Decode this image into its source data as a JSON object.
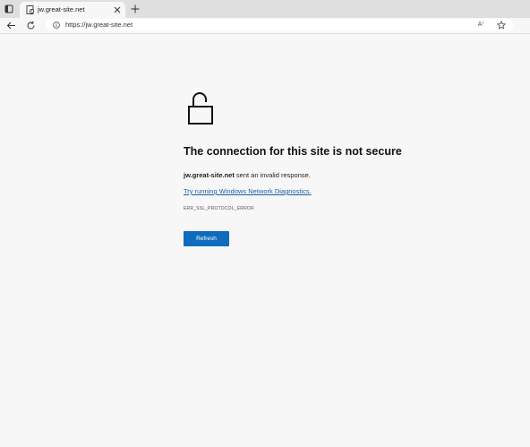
{
  "browser": {
    "tab": {
      "title": "jw.great-site.net"
    },
    "address_bar": {
      "url": "https://jw.great-site.net"
    },
    "toolbar_icons": [
      "back-arrow-icon",
      "reload-icon",
      "info-icon",
      "read-aloud-icon",
      "star-icon"
    ],
    "read_aloud_label": "A⁾"
  },
  "page": {
    "icon": "unlocked-padlock-icon",
    "title": "The connection for this site is not secure",
    "description_host": "jw.great-site.net",
    "description_rest": " sent an invalid response.",
    "diagnostics_link": "Try running Windows Network Diagnostics",
    "diagnostics_suffix": ".",
    "error_code": "ERR_SSL_PROTOCOL_ERROR",
    "refresh_label": "Refresh"
  },
  "colors": {
    "accent": "#0f6cbd",
    "link": "#1a5fa8",
    "page_background": "#f7f7f7"
  }
}
